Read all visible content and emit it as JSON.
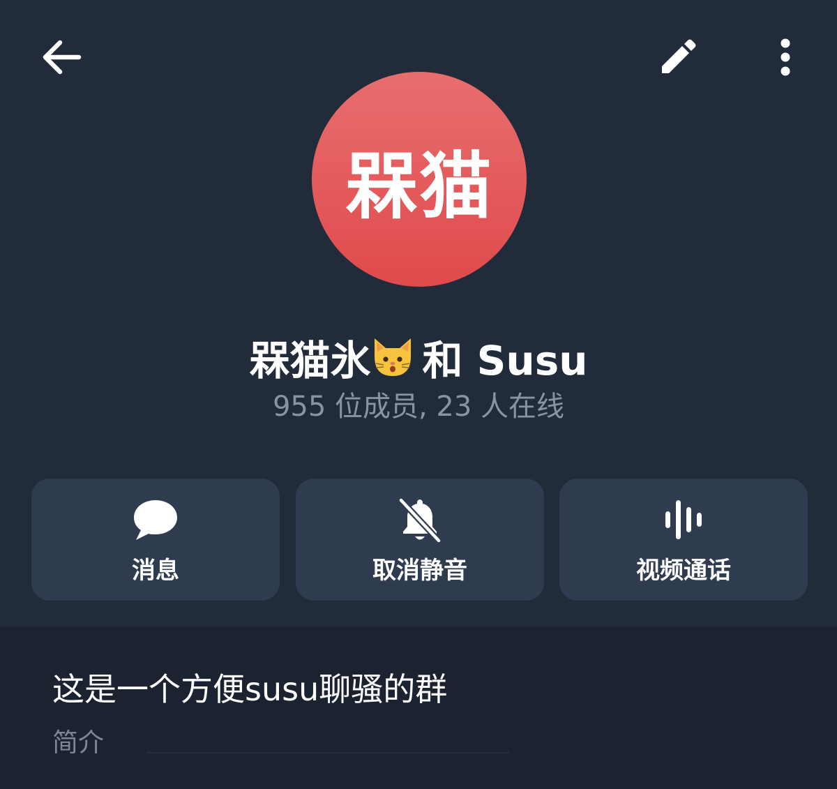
{
  "header": {
    "back_icon": "arrow-left-icon",
    "edit_icon": "pencil-icon",
    "more_icon": "more-vertical-icon"
  },
  "group": {
    "avatar_text": "槑猫",
    "avatar_color": "#e35a5b",
    "name_part1": "槑猫氷",
    "name_emoji": "cat-face-emoji",
    "name_part2": "和 Susu",
    "members_summary": "955 位成员, 23 人在线"
  },
  "actions": [
    {
      "label": "消息",
      "icon": "chat-bubble-icon"
    },
    {
      "label": "取消静音",
      "icon": "bell-off-icon"
    },
    {
      "label": "视频通话",
      "icon": "voice-wave-icon"
    }
  ],
  "info": {
    "bio": "这是一个方便susu聊骚的群",
    "bio_label": "简介"
  },
  "colors": {
    "background": "#222b3a",
    "card": "#2f3b4f",
    "info_background": "#1b2230",
    "secondary_text": "#8994a3"
  }
}
